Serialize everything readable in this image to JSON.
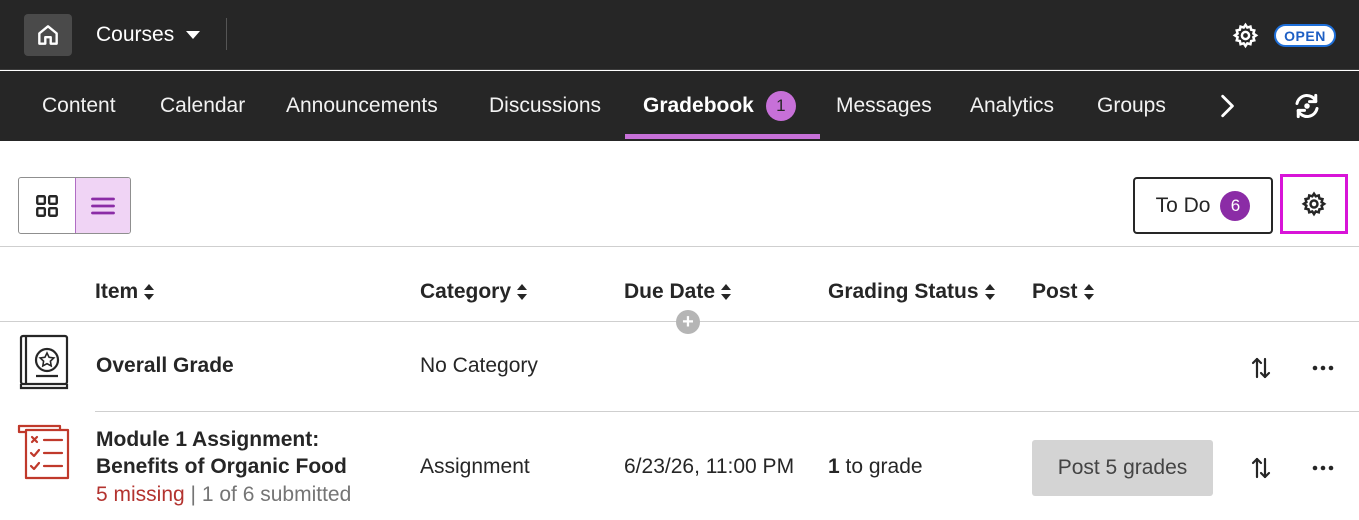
{
  "topbar": {
    "courses_label": "Courses",
    "status_badge": "OPEN",
    "accent_color": "#1e6fd9"
  },
  "nav": {
    "tabs": [
      {
        "label": "Content"
      },
      {
        "label": "Calendar"
      },
      {
        "label": "Announcements"
      },
      {
        "label": "Discussions"
      },
      {
        "label": "Gradebook",
        "count": "1",
        "active": true
      },
      {
        "label": "Messages"
      },
      {
        "label": "Analytics"
      },
      {
        "label": "Groups"
      }
    ],
    "active_color": "#c770d8"
  },
  "toolbar": {
    "todo_label": "To Do",
    "todo_count": "6"
  },
  "table": {
    "headers": [
      "Item",
      "Category",
      "Due Date",
      "Grading Status",
      "Post"
    ],
    "rows": [
      {
        "icon": "overall-grade-book-icon",
        "item": "Overall Grade",
        "category": "No Category"
      },
      {
        "icon": "assignment-checklist-icon",
        "item_line1": "Module 1 Assignment:",
        "item_line2": "Benefits of Organic Food",
        "missing": "5 missing",
        "separator": "|",
        "submitted": "1 of 6 submitted",
        "category": "Assignment",
        "due_date": "6/23/26, 11:00 PM",
        "grading_count": "1",
        "grading_text": " to grade",
        "post_label": "Post 5 grades"
      }
    ]
  }
}
